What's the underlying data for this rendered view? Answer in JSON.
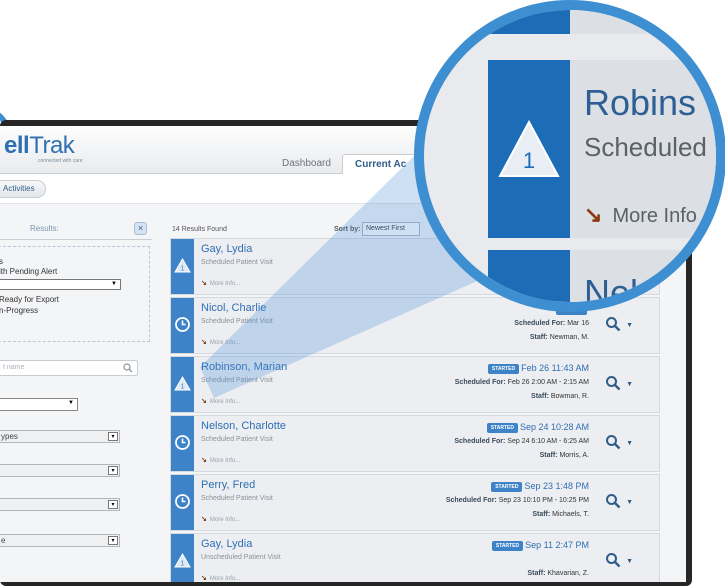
{
  "app": {
    "logo_part1": "ell",
    "logo_part2": "Trak",
    "tagline": "connected with care"
  },
  "tabs": [
    {
      "label": "Dashboard"
    },
    {
      "label": "Current Ac"
    }
  ],
  "subnav": {
    "activities_label": "Activities"
  },
  "filters": {
    "header": "Results:",
    "clear_icon": "close-icon",
    "lines": [
      "s",
      "ith Pending Alert",
      "Ready for Export",
      "n-Progress"
    ],
    "search_placeholder": "t name",
    "dropdowns": [
      "ypes",
      "",
      "",
      "e"
    ]
  },
  "results": {
    "count_label": "14 Results Found",
    "sort_label": "Sort by:",
    "sort_value": "Newest First"
  },
  "cards": [
    {
      "name": "Gay, Lydia",
      "visit_type": "Scheduled Patient Visit",
      "more": "More Info...",
      "status_icon": "alert-triangle-icon",
      "badge": "",
      "started": "",
      "sched_label": "Sche",
      "sched_value": "",
      "staff_label": "",
      "staff_value": ""
    },
    {
      "name": "Nicol, Charlie",
      "visit_type": "Scheduled Patient Visit",
      "more": "More Info...",
      "status_icon": "clock-icon",
      "badge": "STARTED",
      "started": "",
      "sched_label": "Scheduled For:",
      "sched_value": "Mar 16",
      "staff_label": "Staff:",
      "staff_value": "Newman, M."
    },
    {
      "name": "Robinson, Marian",
      "visit_type": "Scheduled Patient Visit",
      "more": "More Info...",
      "status_icon": "alert-triangle-icon",
      "badge": "STARTED",
      "started": "Feb 26 11:43 AM",
      "sched_label": "Scheduled For:",
      "sched_value": "Feb 26 2:00 AM - 2:15 AM",
      "staff_label": "Staff:",
      "staff_value": "Bowman, R."
    },
    {
      "name": "Nelson, Charlotte",
      "visit_type": "Scheduled Patient Visit",
      "more": "More Info...",
      "status_icon": "clock-icon",
      "badge": "STARTED",
      "started": "Sep 24 10:28 AM",
      "sched_label": "Scheduled For:",
      "sched_value": "Sep 24 6:10 AM - 6:25 AM",
      "staff_label": "Staff:",
      "staff_value": "Morris, A."
    },
    {
      "name": "Perry, Fred",
      "visit_type": "Scheduled Patient Visit",
      "more": "More Info...",
      "status_icon": "clock-icon",
      "badge": "STARTED",
      "started": "Sep 23 1:48 PM",
      "sched_label": "Scheduled For:",
      "sched_value": "Sep 23 10:10 PM - 10:25 PM",
      "staff_label": "Staff:",
      "staff_value": "Michaels, T."
    },
    {
      "name": "Gay, Lydia",
      "visit_type": "Unscheduled Patient Visit",
      "more": "More Info...",
      "status_icon": "alert-triangle-icon",
      "badge": "STARTED",
      "started": "Sep 11 2:47 PM",
      "sched_label": "",
      "sched_value": "",
      "staff_label": "Staff:",
      "staff_value": "Khavarian, Z."
    }
  ],
  "zoom": {
    "name": "Robins",
    "visit_type": "Scheduled",
    "number": "1",
    "more": "More Info",
    "next_name": "Nel"
  },
  "colors": {
    "accent": "#3d8fd1",
    "card_strip": "#3e83c8",
    "link": "#2f6fb3"
  }
}
